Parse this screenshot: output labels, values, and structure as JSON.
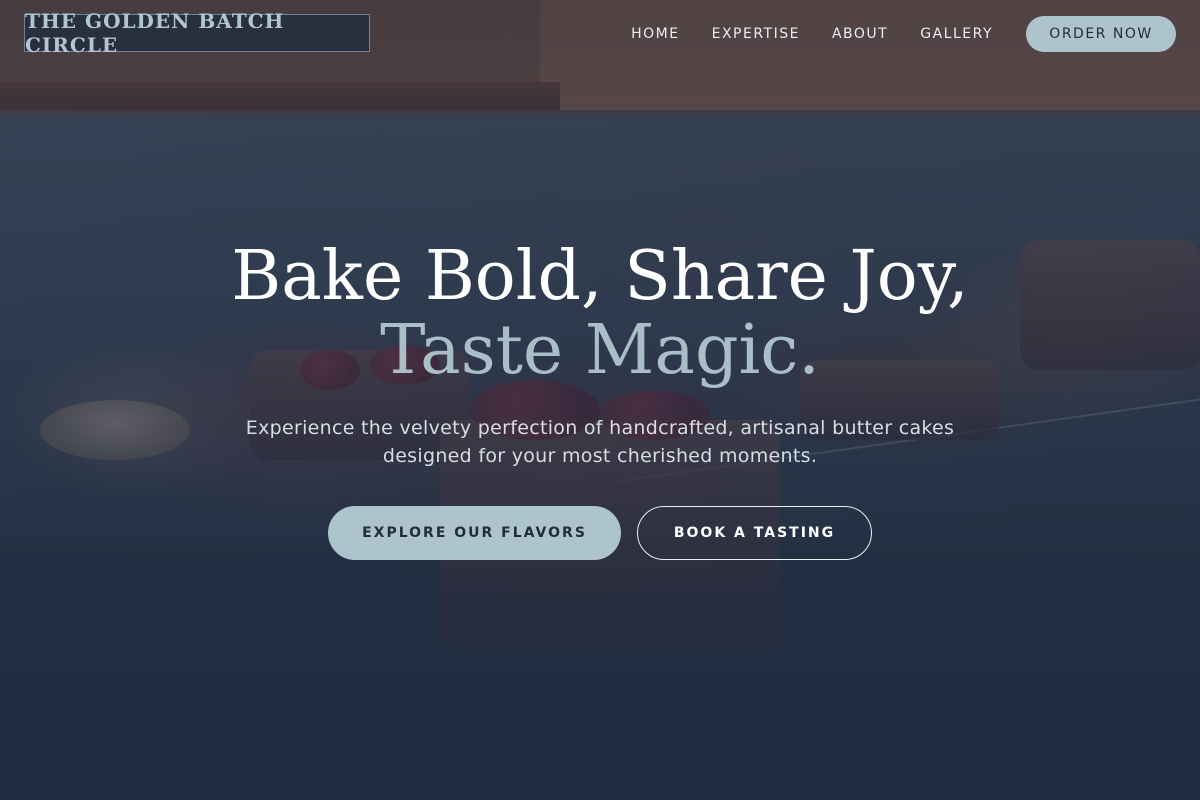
{
  "brand": {
    "logo_text": "THE GOLDEN BATCH CIRCLE"
  },
  "nav": {
    "items": [
      {
        "label": "HOME"
      },
      {
        "label": "EXPERTISE"
      },
      {
        "label": "ABOUT"
      },
      {
        "label": "GALLERY"
      }
    ],
    "cta_label": "ORDER NOW"
  },
  "hero": {
    "headline_main": "Bake Bold, Share Joy, ",
    "headline_accent": "Taste Magic.",
    "subtitle": "Experience the velvety perfection of handcrafted, artisanal butter cakes designed for your most cherished moments.",
    "primary_button": "EXPLORE OUR FLAVORS",
    "secondary_button": "BOOK A TASTING"
  },
  "colors": {
    "accent": "#aec4cc",
    "overlay": "#1f2c40",
    "text_primary": "#ffffff",
    "logo_text": "#b2c6d0"
  }
}
